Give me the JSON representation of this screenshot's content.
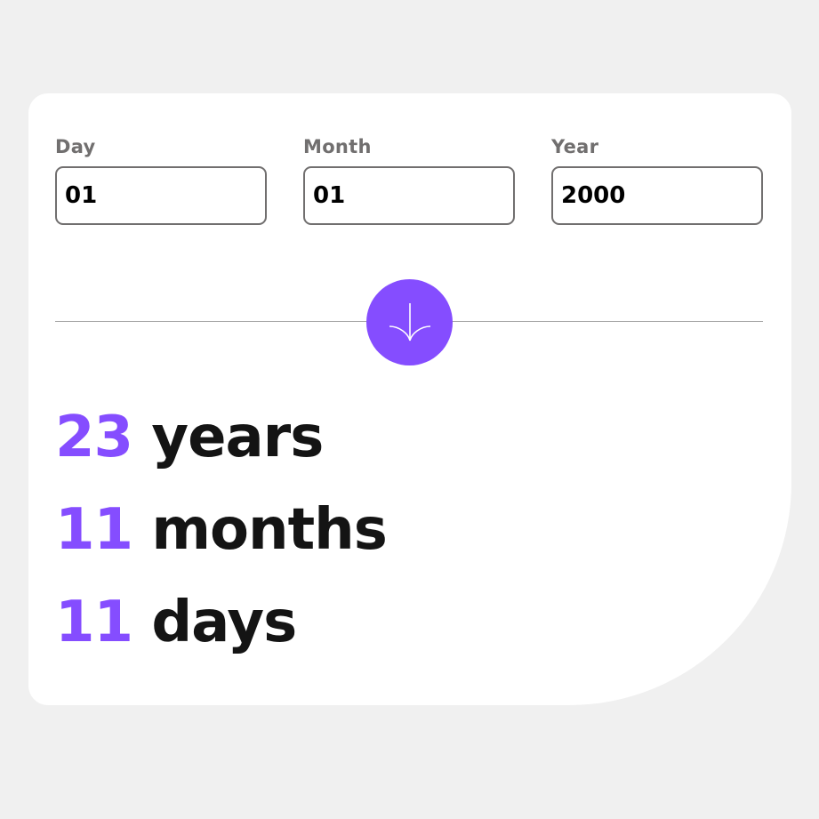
{
  "form": {
    "day": {
      "label": "Day",
      "value": "01"
    },
    "month": {
      "label": "Month",
      "value": "01"
    },
    "year": {
      "label": "Year",
      "value": "2000"
    }
  },
  "submit": {
    "icon": "arrow-down-icon",
    "color": "#854dff"
  },
  "results": {
    "years": {
      "value": "23",
      "unit": "years"
    },
    "months": {
      "value": "11",
      "unit": "months"
    },
    "days": {
      "value": "11",
      "unit": "days"
    }
  },
  "colors": {
    "accent": "#854dff",
    "label": "#716f6f",
    "background": "#f0f0f0",
    "card": "#ffffff"
  }
}
